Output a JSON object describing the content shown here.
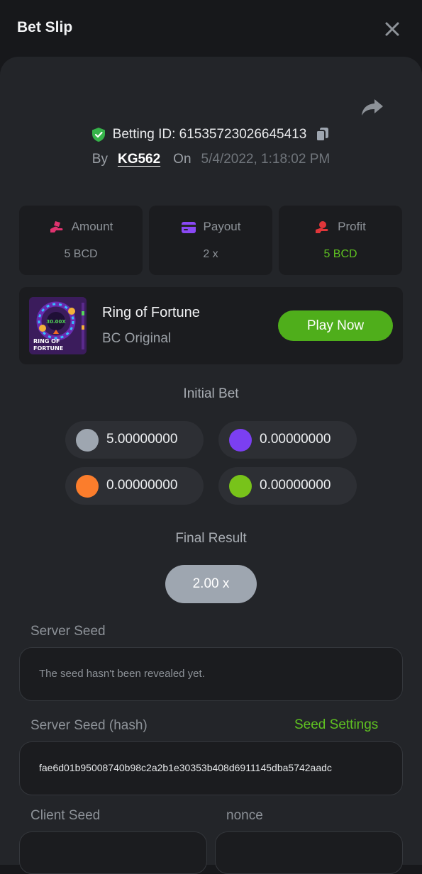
{
  "header": {
    "title": "Bet Slip",
    "close_icon": "close-icon"
  },
  "bet": {
    "id_label": "Betting ID: 61535723026645413",
    "by_label": "By",
    "user": "KG562",
    "on_label": "On",
    "date": "5/4/2022, 1:18:02 PM"
  },
  "stats": [
    {
      "label": "Amount",
      "value": "5 BCD",
      "icon": "bet-hand-icon",
      "icon_color": "#e0336f"
    },
    {
      "label": "Payout",
      "value": "2 x",
      "icon": "card-icon",
      "icon_color": "#8a48f5"
    },
    {
      "label": "Profit",
      "value": "5 BCD",
      "icon": "profit-hand-icon",
      "icon_color": "#e0363a",
      "value_color": "#5fc221"
    }
  ],
  "game": {
    "name": "Ring of Fortune",
    "provider": "BC Original",
    "play_label": "Play Now",
    "thumb_multiplier": "30.00X",
    "thumb_title_1": "RING OF",
    "thumb_title_2": "FORTUNE"
  },
  "initial_bet": {
    "title": "Initial Bet",
    "coins": [
      {
        "value": "5.00000000",
        "color": "#9ea6b0"
      },
      {
        "value": "0.00000000",
        "color": "#7b3ff2"
      },
      {
        "value": "0.00000000",
        "color": "#fb7d2c"
      },
      {
        "value": "0.00000000",
        "color": "#78c31a"
      }
    ]
  },
  "final_result": {
    "title": "Final Result",
    "value": "2.00 x"
  },
  "server_seed": {
    "label": "Server Seed",
    "value": "The seed hasn't been revealed yet."
  },
  "server_seed_hash": {
    "label": "Server Seed (hash)",
    "link": "Seed Settings",
    "value": "fae6d01b95008740b98c2a2b1e30353b408d6911145dba5742aadc"
  },
  "client_seed": {
    "label": "Client Seed"
  },
  "nonce": {
    "label": "nonce"
  }
}
